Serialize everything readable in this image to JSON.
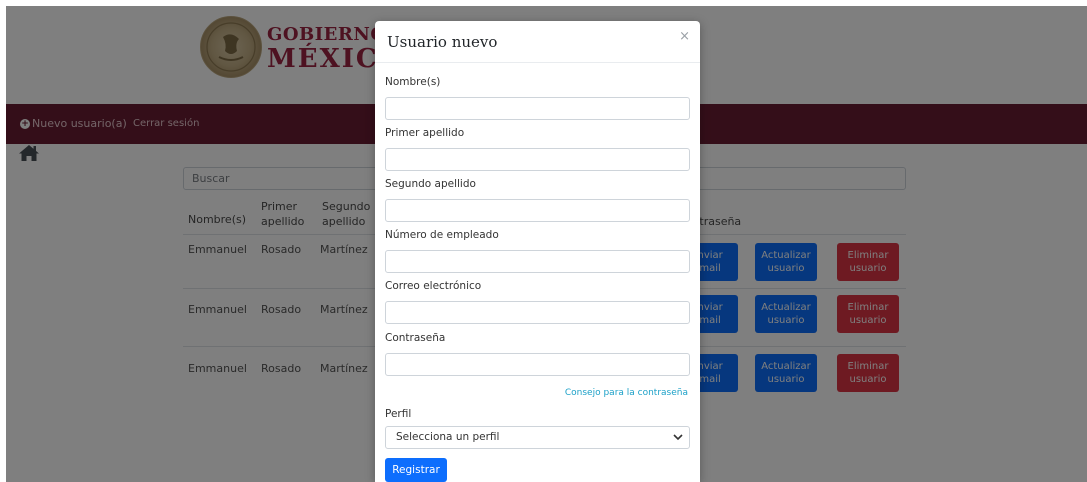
{
  "header": {
    "logo_line1": "GOBIERNO DE",
    "logo_line2": "MÉXICO"
  },
  "navbar": {
    "new_user_label": "Nuevo usuario(a)",
    "logout_label": "Cerrar sesión"
  },
  "search": {
    "placeholder": "Buscar"
  },
  "table": {
    "columns": [
      "Nombre(s)",
      "Primer apellido",
      "Segundo apellido",
      "Contraseña"
    ],
    "rows": [
      {
        "nombre": "Emmanuel",
        "primer": "Rosado",
        "segundo": "Martínez"
      },
      {
        "nombre": "Emmanuel",
        "primer": "Rosado",
        "segundo": "Martínez"
      },
      {
        "nombre": "Emmanuel",
        "primer": "Rosado",
        "segundo": "Martínez"
      }
    ],
    "buttons": {
      "email": "Enviar email",
      "update": "Actualizar usuario",
      "delete": "Eliminar usuario"
    }
  },
  "modal": {
    "title": "Usuario nuevo",
    "close": "×",
    "fields": {
      "nombre": {
        "label": "Nombre(s)",
        "value": ""
      },
      "primer_apellido": {
        "label": "Primer apellido",
        "value": ""
      },
      "segundo_apellido": {
        "label": "Segundo apellido",
        "value": ""
      },
      "numero_empleado": {
        "label": "Número de empleado",
        "value": ""
      },
      "correo": {
        "label": "Correo electrónico",
        "value": ""
      },
      "contrasena": {
        "label": "Contraseña",
        "value": ""
      }
    },
    "password_hint": "Consejo para la contraseña",
    "perfil": {
      "label": "Perfil",
      "selected": "Selecciona un perfil"
    },
    "submit_label": "Registrar"
  },
  "colors": {
    "brand": "#691c32",
    "primary": "#0d6efd",
    "danger": "#dc3545",
    "logo_text": "#9c2543"
  }
}
